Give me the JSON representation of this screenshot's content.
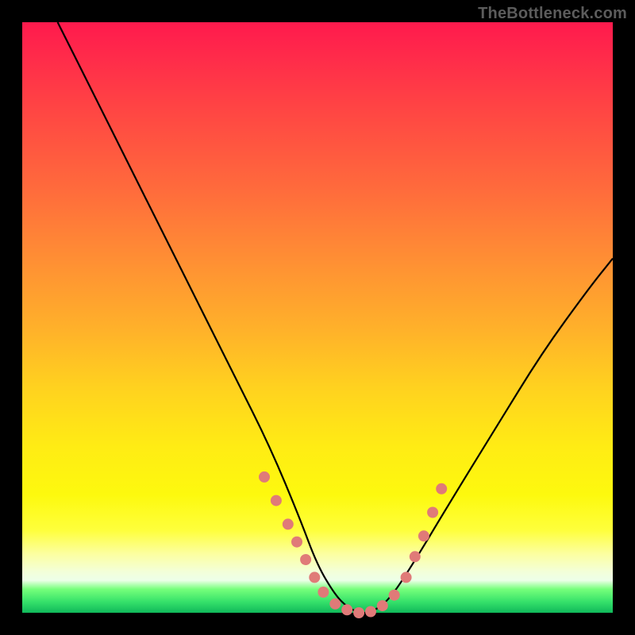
{
  "watermark": "TheBottleneck.com",
  "chart_data": {
    "type": "line",
    "title": "",
    "xlabel": "",
    "ylabel": "",
    "xlim": [
      0,
      100
    ],
    "ylim": [
      0,
      100
    ],
    "grid": false,
    "series": [
      {
        "name": "bottleneck-curve",
        "color": "#000000",
        "x": [
          6,
          12,
          18,
          24,
          30,
          36,
          42,
          47,
          50,
          53,
          55,
          57,
          59,
          62,
          66,
          72,
          80,
          88,
          96,
          100
        ],
        "y": [
          100,
          88,
          76,
          64,
          52,
          40,
          28,
          16,
          8,
          3,
          1,
          0,
          0,
          2,
          8,
          18,
          31,
          44,
          55,
          60
        ]
      }
    ],
    "markers": [
      {
        "name": "highlight-dots",
        "color": "#e07a78",
        "radius_px": 7,
        "points": [
          {
            "x": 41,
            "y": 23
          },
          {
            "x": 43,
            "y": 19
          },
          {
            "x": 45,
            "y": 15
          },
          {
            "x": 46.5,
            "y": 12
          },
          {
            "x": 48,
            "y": 9
          },
          {
            "x": 49.5,
            "y": 6
          },
          {
            "x": 51,
            "y": 3.5
          },
          {
            "x": 53,
            "y": 1.5
          },
          {
            "x": 55,
            "y": 0.5
          },
          {
            "x": 57,
            "y": 0
          },
          {
            "x": 59,
            "y": 0.2
          },
          {
            "x": 61,
            "y": 1.2
          },
          {
            "x": 63,
            "y": 3
          },
          {
            "x": 65,
            "y": 6
          },
          {
            "x": 66.5,
            "y": 9.5
          },
          {
            "x": 68,
            "y": 13
          },
          {
            "x": 69.5,
            "y": 17
          },
          {
            "x": 71,
            "y": 21
          }
        ]
      }
    ]
  }
}
